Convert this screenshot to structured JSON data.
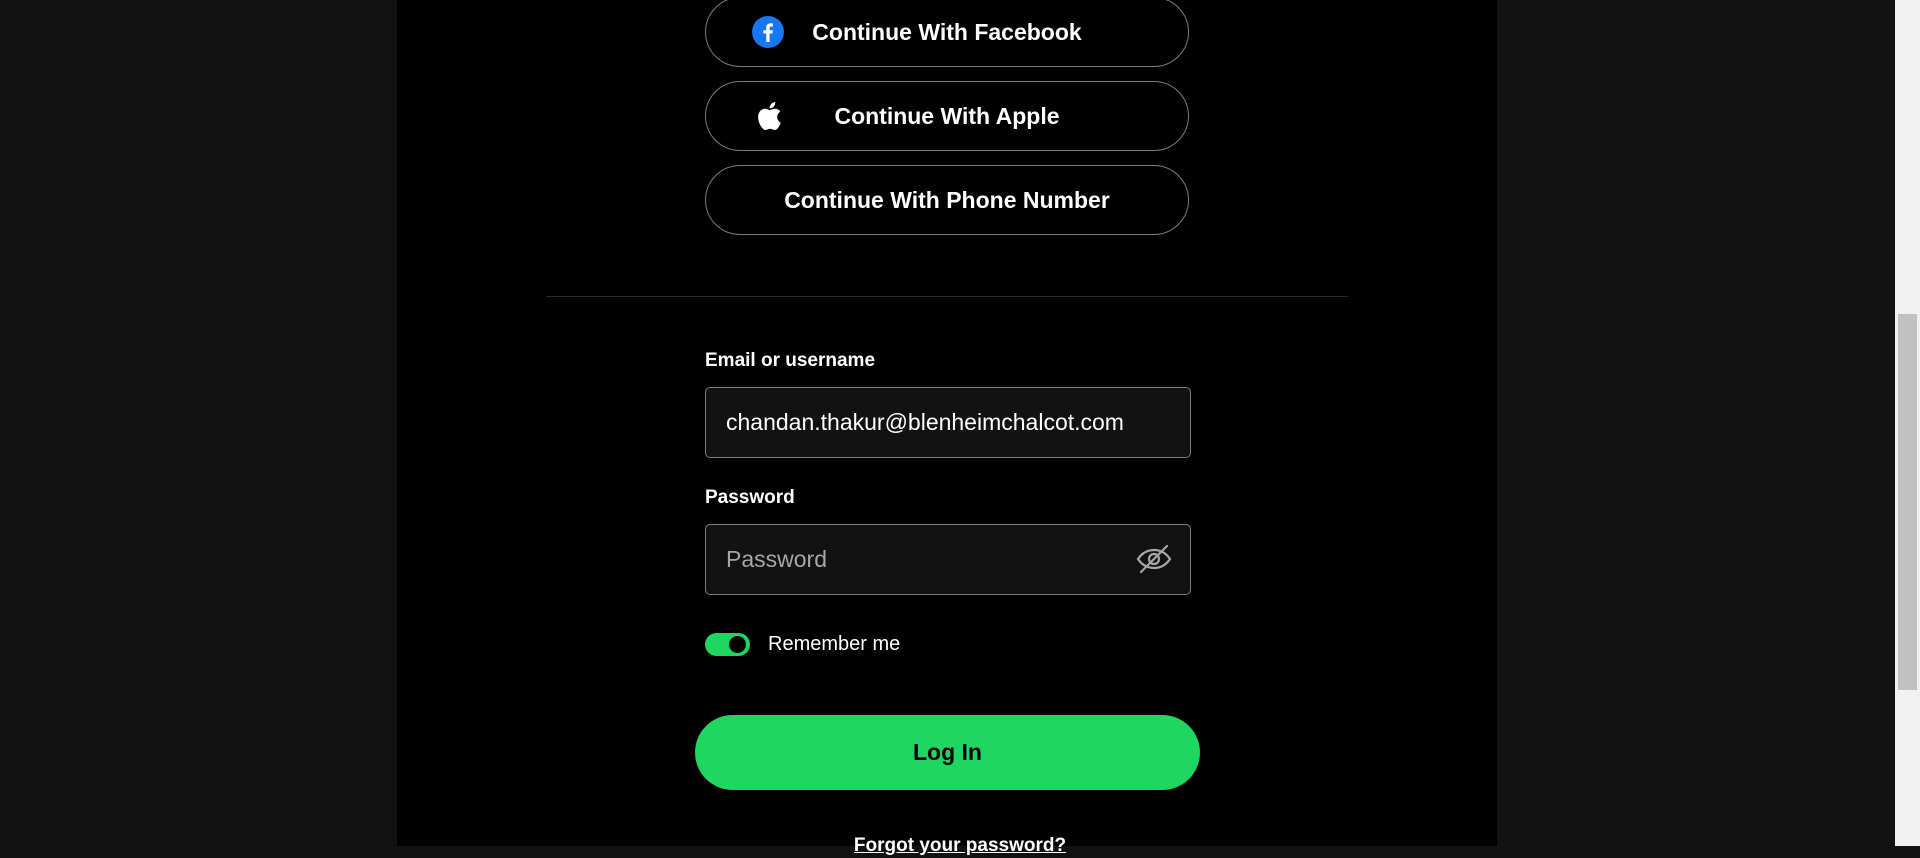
{
  "oauth": {
    "facebook_label": "Continue With Facebook",
    "apple_label": "Continue With Apple",
    "phone_label": "Continue With Phone Number"
  },
  "form": {
    "email_label": "Email or username",
    "email_value": "chandan.thakur@blenheimchalcot.com",
    "password_label": "Password",
    "password_placeholder": "Password",
    "remember_label": "Remember me",
    "remember_on": true,
    "login_label": "Log In",
    "forgot_label": "Forgot your password?"
  },
  "colors": {
    "accent": "#1ed760",
    "facebook": "#1877f2",
    "card_bg": "#000000",
    "page_bg": "#121212"
  },
  "icons": {
    "facebook": "facebook-icon",
    "apple": "apple-icon",
    "password_toggle": "eye-slash-icon"
  }
}
